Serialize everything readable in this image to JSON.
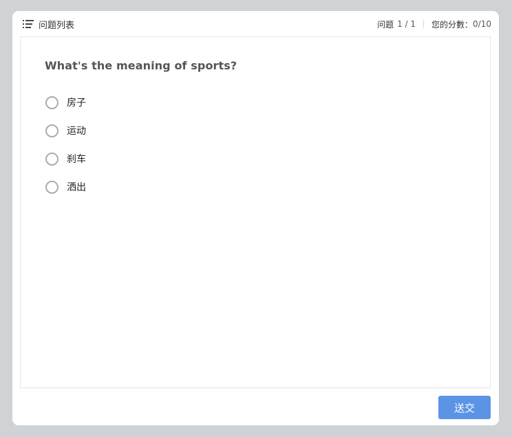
{
  "header": {
    "question_list_label": "问题列表",
    "question_label": "问题",
    "question_counter": "1 / 1",
    "score_label": "您的分數：",
    "score_value": "0/10"
  },
  "question": {
    "text": "What's the meaning of sports?",
    "options": [
      {
        "label": "房子"
      },
      {
        "label": "运动"
      },
      {
        "label": "刹车"
      },
      {
        "label": "洒出"
      }
    ]
  },
  "footer": {
    "submit_label": "送交",
    "submit_color": "#5b93e5"
  },
  "icons": {
    "question_list": "list-icon"
  }
}
